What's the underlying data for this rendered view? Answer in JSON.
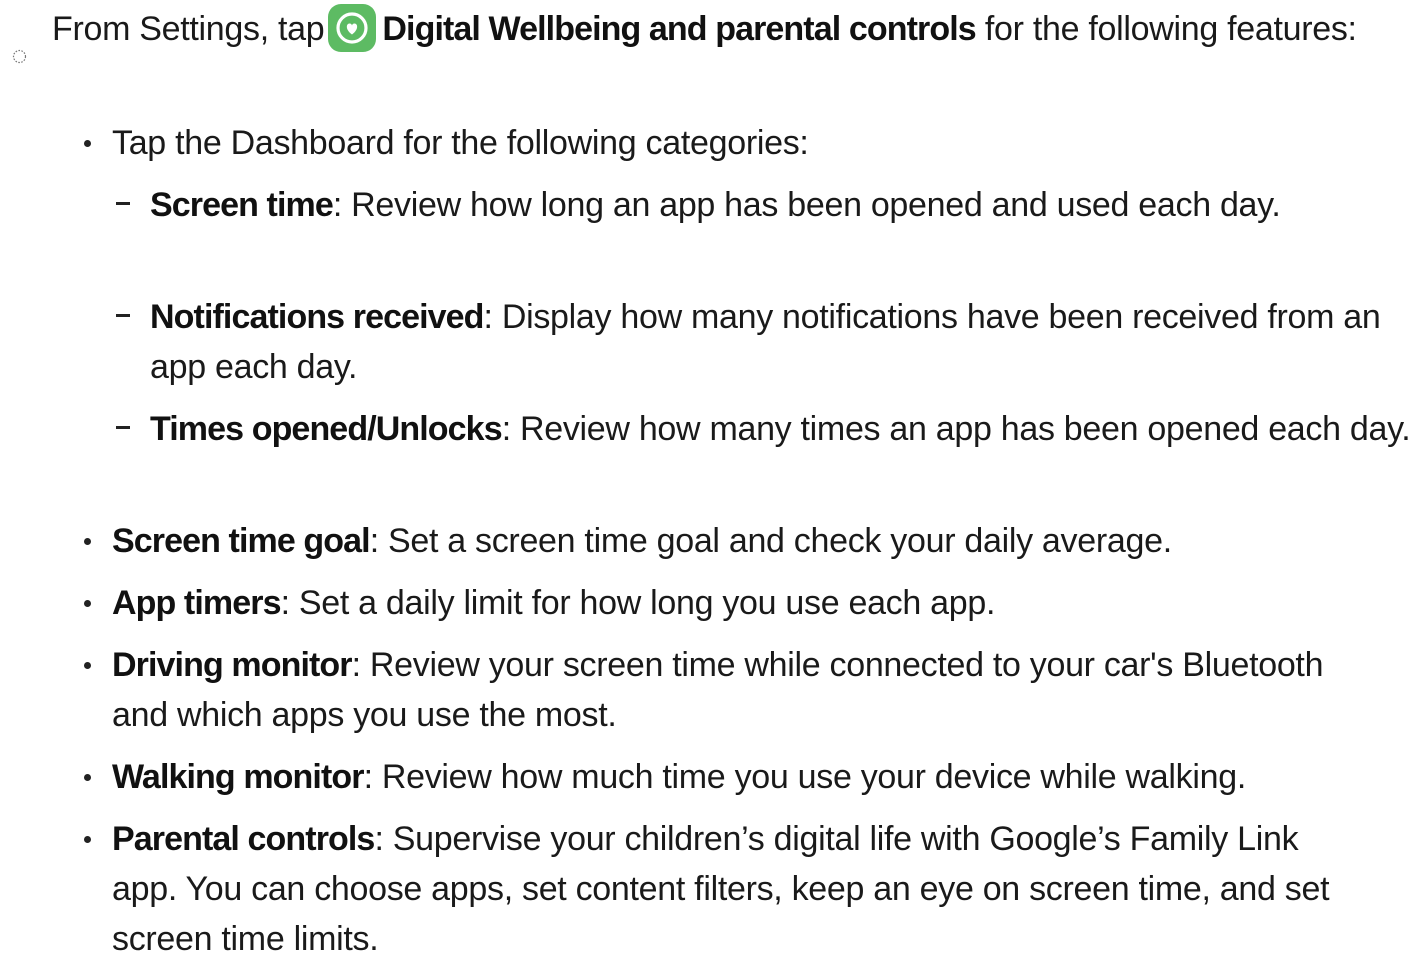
{
  "instruction": {
    "prefix": "From Settings, tap",
    "app_icon": "digital-wellbeing-icon",
    "app_name": "Digital Wellbeing and parental controls",
    "suffix": " for the following features:"
  },
  "dashboard": {
    "intro": "Tap the Dashboard for the following categories:",
    "categories": [
      {
        "term": "Screen time",
        "desc": ": Review how long an app has been opened and used each day."
      },
      {
        "term": "Notifications received",
        "desc": ": Display how many notifications have been received from an app each day."
      },
      {
        "term": "Times opened/Unlocks",
        "desc": ": Review how many times an app has been opened each day."
      }
    ]
  },
  "features": [
    {
      "term": "Screen time goal",
      "desc": ": Set a screen time goal and check your daily average."
    },
    {
      "term": "App timers",
      "desc": ": Set a daily limit for how long you use each app."
    },
    {
      "term": "Driving monitor",
      "desc": ": Review your screen time while connected to your car's Bluetooth and which apps you use the most."
    },
    {
      "term": "Walking monitor",
      "desc": ": Review how much time you use your device while walking."
    },
    {
      "term": "Parental controls",
      "desc": ": Supervise your children’s digital life with Google’s Family Link app. You can choose apps, set content filters, keep an eye on screen time, and set screen time limits."
    }
  ],
  "colors": {
    "icon_green": "#5DBB63",
    "text": "#1a1a1a"
  }
}
